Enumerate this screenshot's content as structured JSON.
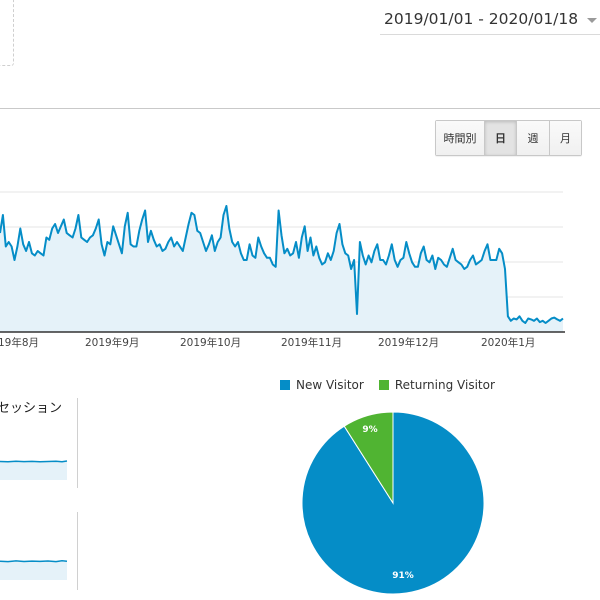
{
  "header": {
    "date_range": "2019/01/01 - 2020/01/18"
  },
  "granularity": {
    "buttons": [
      {
        "label": "時間別",
        "active": false
      },
      {
        "label": "日",
        "active": true
      },
      {
        "label": "週",
        "active": false
      },
      {
        "label": "月",
        "active": false
      }
    ]
  },
  "colors": {
    "line": "#058dc7",
    "area": "#e5f2f9",
    "new_visitor": "#058dc7",
    "returning_visitor": "#50b432"
  },
  "chart_data": [
    {
      "type": "area",
      "x_tick_labels": [
        "19年8月",
        "2019年9月",
        "2019年10月",
        "2019年11月",
        "2019年12月",
        "2020年1月"
      ],
      "grid": true,
      "note": "daily sessions line; y-axis labels cropped out of view",
      "values": [
        2.2,
        2.6,
        1.9,
        2.0,
        1.9,
        1.6,
        1.9,
        2.3,
        1.95,
        1.8,
        2.0,
        1.75,
        1.7,
        1.8,
        1.75,
        1.7,
        2.1,
        2.05,
        2.3,
        2.4,
        2.2,
        2.35,
        2.5,
        2.2,
        2.15,
        2.1,
        2.3,
        2.6,
        2.1,
        2.05,
        2.0,
        2.1,
        2.15,
        2.3,
        2.5,
        1.95,
        1.7,
        2.0,
        1.95,
        2.35,
        2.15,
        1.95,
        1.75,
        2.35,
        2.65,
        1.95,
        1.9,
        1.9,
        2.25,
        2.5,
        2.7,
        2.0,
        2.25,
        2.05,
        1.9,
        1.95,
        1.8,
        1.85,
        2.0,
        2.1,
        1.9,
        2.0,
        1.9,
        1.8,
        2.1,
        2.4,
        2.65,
        2.6,
        2.25,
        2.2,
        2.0,
        1.8,
        1.95,
        2.15,
        1.8,
        2.0,
        2.1,
        2.6,
        2.8,
        2.3,
        2.0,
        1.9,
        2.0,
        1.75,
        1.6,
        1.6,
        1.95,
        1.7,
        1.65,
        2.1,
        1.9,
        1.75,
        1.65,
        1.65,
        1.5,
        1.45,
        2.7,
        2.15,
        1.75,
        1.85,
        1.7,
        1.75,
        2.0,
        1.65,
        2.1,
        2.35,
        1.8,
        2.1,
        1.7,
        1.9,
        1.65,
        1.5,
        1.55,
        1.75,
        1.6,
        1.8,
        2.2,
        2.4,
        1.95,
        1.75,
        1.7,
        1.4,
        1.6,
        0.4,
        2.0,
        1.7,
        1.5,
        1.7,
        1.55,
        1.8,
        1.95,
        1.6,
        1.6,
        1.5,
        1.7,
        1.95,
        1.6,
        1.45,
        1.6,
        1.65,
        2.0,
        1.75,
        1.55,
        1.45,
        1.45,
        1.75,
        1.9,
        1.6,
        1.55,
        1.7,
        1.4,
        1.65,
        1.6,
        1.5,
        1.45,
        1.65,
        1.85,
        1.6,
        1.55,
        1.5,
        1.4,
        1.45,
        1.6,
        1.7,
        1.5,
        1.55,
        1.6,
        1.8,
        1.95,
        1.6,
        1.6,
        1.6,
        1.85,
        1.75,
        1.4,
        0.35,
        0.25,
        0.3,
        0.28,
        0.35,
        0.25,
        0.2,
        0.3,
        0.28,
        0.25,
        0.3,
        0.22,
        0.25,
        0.2,
        0.25,
        0.3,
        0.32,
        0.28,
        0.25,
        0.3
      ]
    },
    {
      "type": "pie",
      "slices": [
        {
          "name": "New Visitor",
          "value": 91,
          "label": "91%"
        },
        {
          "name": "Returning Visitor",
          "value": 9,
          "label": "9%"
        }
      ]
    }
  ],
  "legend": {
    "new_visitor": "New Visitor",
    "returning_visitor": "Returning Visitor"
  },
  "metrics": {
    "title": "セッション"
  }
}
